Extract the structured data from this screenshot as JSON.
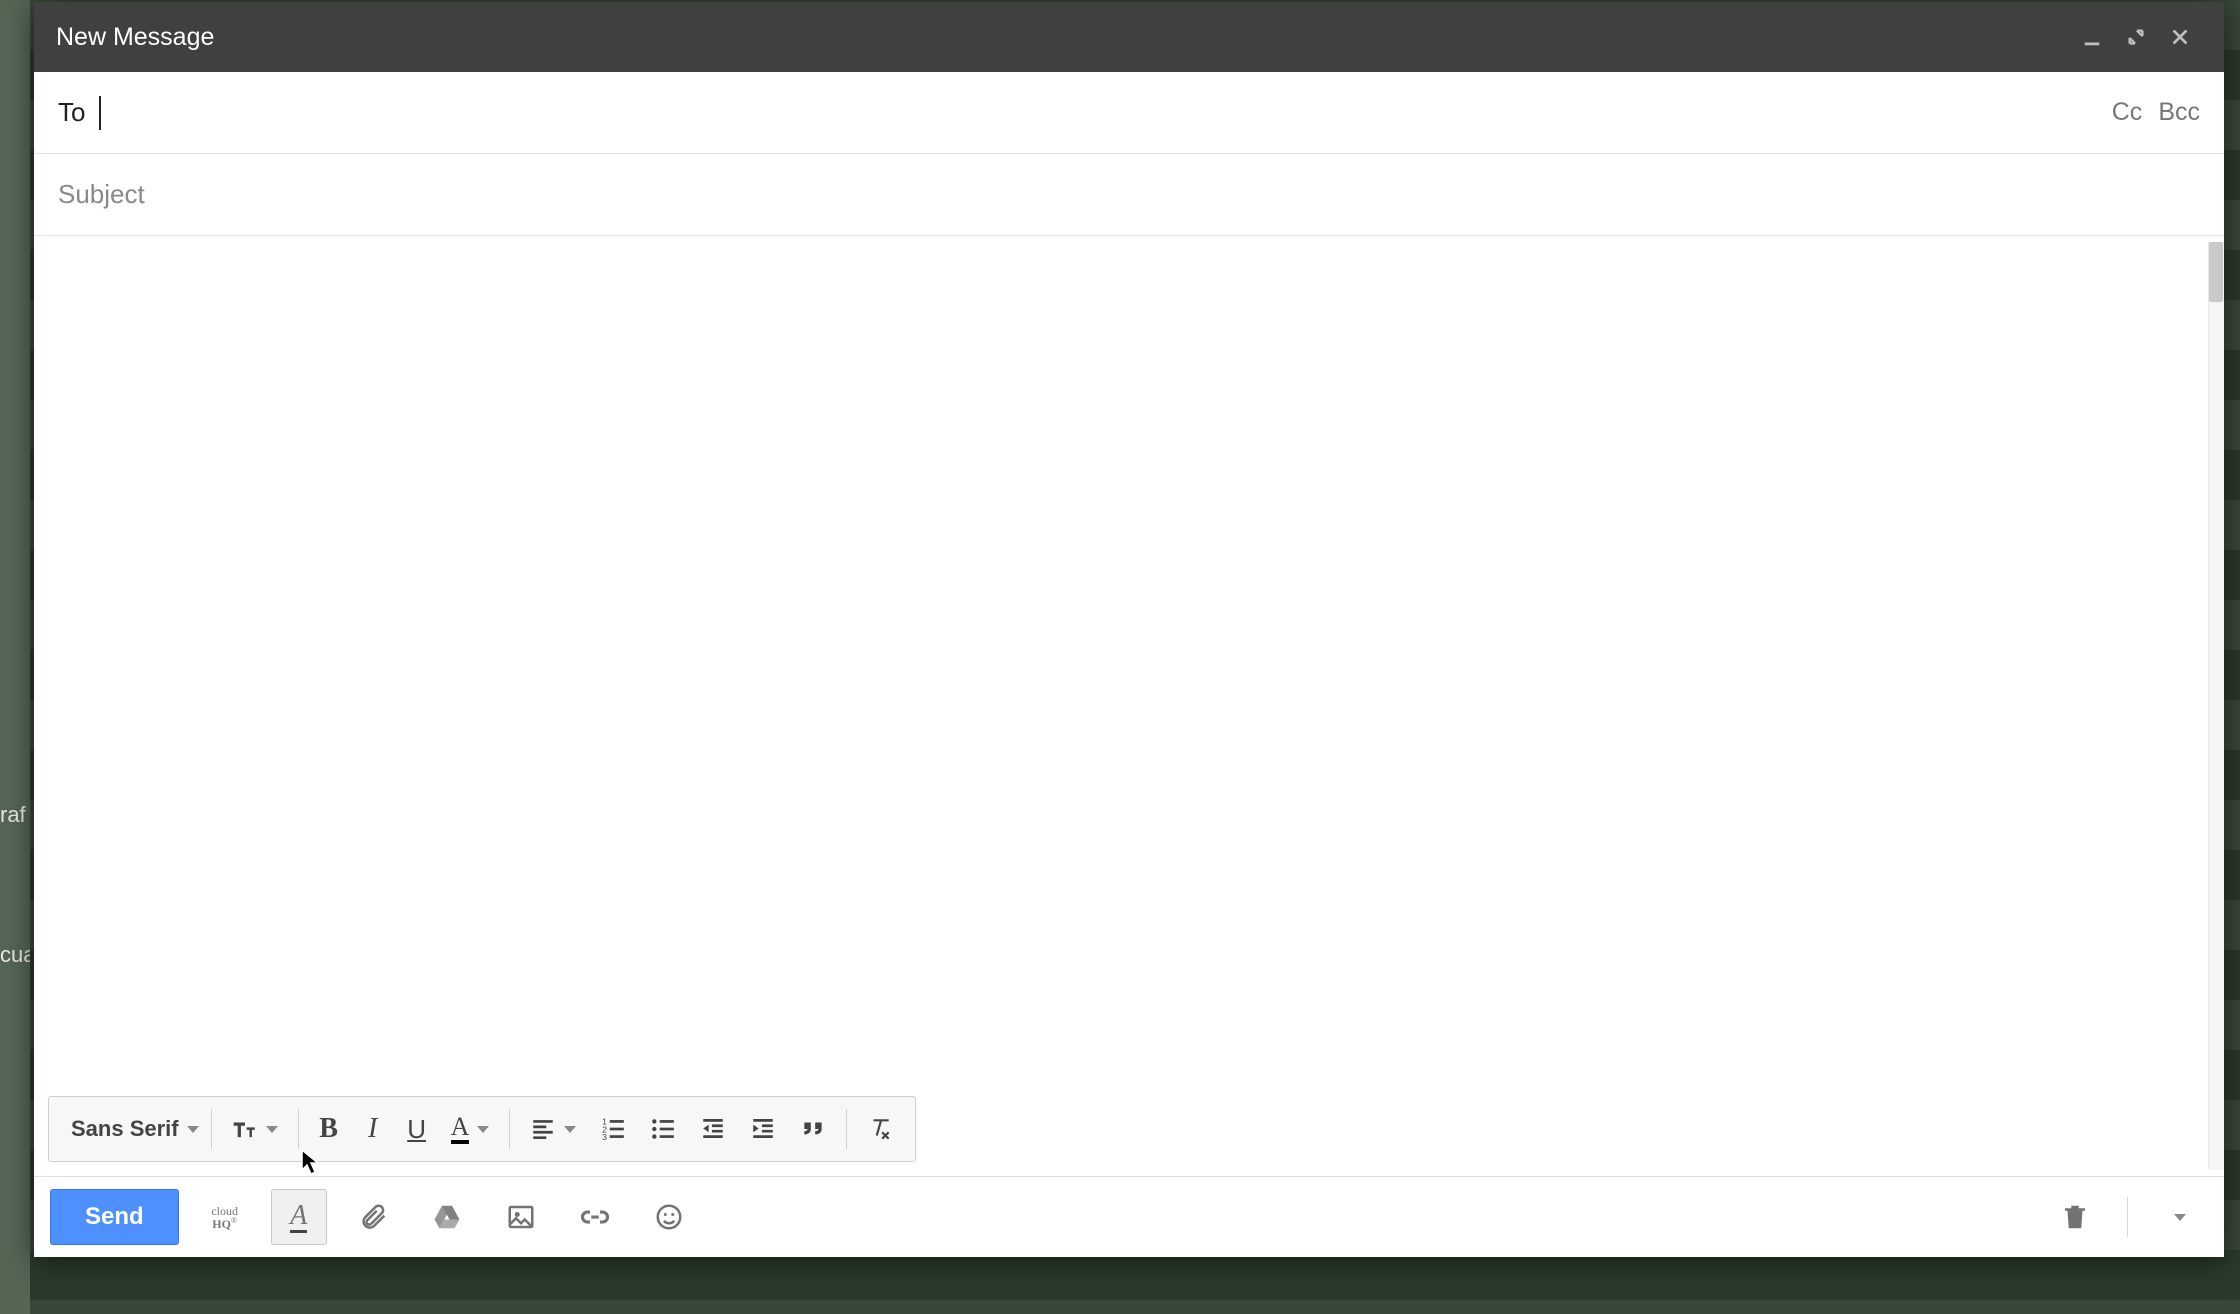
{
  "window": {
    "title": "New Message"
  },
  "fields": {
    "to_label": "To",
    "to_value": "",
    "cc_label": "Cc",
    "bcc_label": "Bcc",
    "subject_placeholder": "Subject",
    "subject_value": ""
  },
  "format_toolbar": {
    "font_family": "Sans Serif"
  },
  "actions": {
    "send_label": "Send"
  },
  "icons": {
    "minimize": "minimize",
    "popout": "popout",
    "close": "close",
    "text_size": "text-size",
    "bold": "B",
    "italic": "I",
    "underline": "U",
    "text_color": "A",
    "align": "align",
    "numbered_list": "numbered-list",
    "bulleted_list": "bulleted-list",
    "indent_less": "indent-less",
    "indent_more": "indent-more",
    "quote": "quote",
    "remove_formatting": "remove-formatting",
    "cloudhq": "cloud HQ",
    "formatting_A": "A",
    "attachment": "attachment",
    "drive": "drive",
    "photo": "photo",
    "link": "link",
    "emoji": "emoji",
    "trash": "trash",
    "more": "more"
  }
}
